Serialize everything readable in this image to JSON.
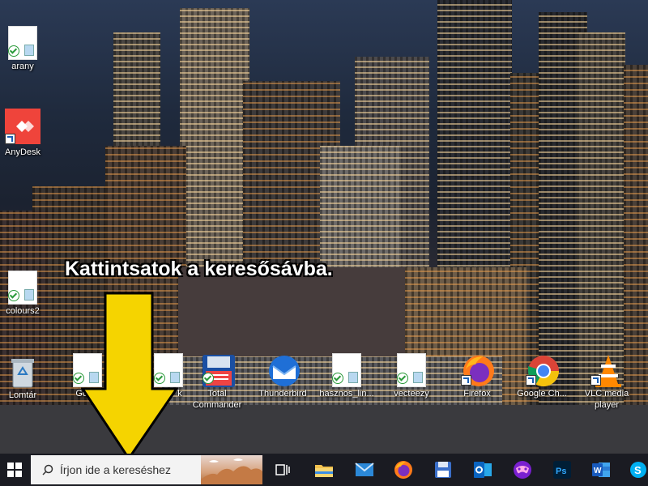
{
  "desktop": {
    "icons": [
      {
        "label": "arany",
        "icon": "document-icon"
      },
      {
        "label": "AnyDesk",
        "icon": "anydesk-icon"
      },
      {
        "label": "colours2",
        "icon": "document-icon"
      },
      {
        "label": "Lomtár",
        "icon": "recycle-bin-icon"
      },
      {
        "label": "Golde",
        "icon": "document-icon"
      },
      {
        "label": "k",
        "icon": "document-icon"
      },
      {
        "label": "Total Commander",
        "icon": "total-commander-icon"
      },
      {
        "label": "Thunderbird",
        "icon": "thunderbird-icon"
      },
      {
        "label": "hasznos_lin...",
        "icon": "document-icon"
      },
      {
        "label": "vecteezy",
        "icon": "document-icon"
      },
      {
        "label": "Firefox",
        "icon": "firefox-icon"
      },
      {
        "label": "Google Ch...",
        "icon": "chrome-icon"
      },
      {
        "label": "VLC media player",
        "icon": "vlc-icon"
      }
    ]
  },
  "annotation": {
    "text": "Kattintsatok a keresősávba.",
    "arrow_color": "#f5d400"
  },
  "taskbar": {
    "search_placeholder": "Írjon ide a kereséshez",
    "pinned": [
      "task-view-icon",
      "file-explorer-icon",
      "mail-icon",
      "firefox-icon",
      "save-icon",
      "outlook-icon",
      "gamepad-icon",
      "photoshop-icon",
      "word-icon",
      "skype-icon"
    ]
  },
  "colors": {
    "taskbar_bg": "#1a1b22",
    "search_bg": "#f3f3f3",
    "accent": "#f5d400"
  }
}
